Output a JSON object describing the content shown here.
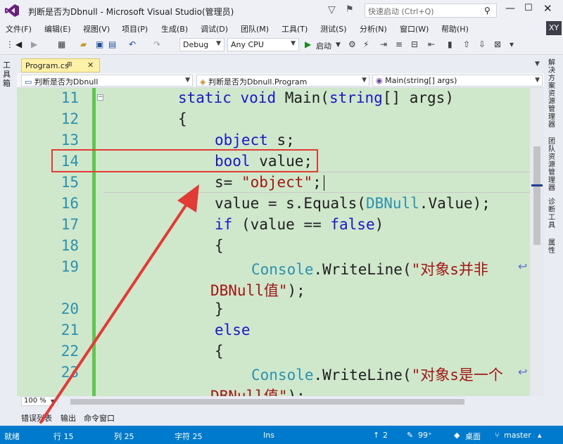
{
  "window": {
    "title": "判断是否为Dbnull - Microsoft Visual Studio(管理员)",
    "quick_launch_placeholder": "快速启动 (Ctrl+Q)",
    "minimize": "—",
    "maximize": "☐",
    "close": "✕",
    "account_initials": "XY"
  },
  "menu": [
    "文件(F)",
    "编辑(E)",
    "视图(V)",
    "项目(P)",
    "生成(B)",
    "调试(D)",
    "团队(M)",
    "工具(T)",
    "测试(S)",
    "分析(N)",
    "窗口(W)",
    "帮助(H)"
  ],
  "toolbar": {
    "configuration": "Debug",
    "platform": "Any CPU",
    "start_label": "启动"
  },
  "left_panel_tab": "工具箱",
  "right_panel_tabs": [
    "解决方案资源管理器",
    "团队资源管理器",
    "诊断工具",
    "属性"
  ],
  "document_tab": {
    "label": "Program.cs",
    "pin": "⊞",
    "close": "✕"
  },
  "navbar": {
    "project": "判断是否为Dbnull",
    "class": "判断是否为Dbnull.Program",
    "member": "Main(string[] args)"
  },
  "code_lines": [
    {
      "number": "11",
      "text": "static void Main(string[] args)"
    },
    {
      "number": "12",
      "text": "{"
    },
    {
      "number": "13",
      "text": "object s;"
    },
    {
      "number": "14",
      "text": "bool value;"
    },
    {
      "number": "15",
      "text": "s= \"object\";"
    },
    {
      "number": "16",
      "text": "value = s.Equals(DBNull.Value);"
    },
    {
      "number": "17",
      "text": "if (value == false)"
    },
    {
      "number": "18",
      "text": "{"
    },
    {
      "number": "19",
      "text": "Console.WriteLine(\"对象s并非DBNull值\");"
    },
    {
      "number": "20",
      "text": "}"
    },
    {
      "number": "21",
      "text": "else"
    },
    {
      "number": "22",
      "text": "{"
    },
    {
      "number": "23",
      "text": "Console.WriteLine(\"对象s是一个DBNull值\");"
    }
  ],
  "zoom": "100 %",
  "bottom_tabs": [
    "错误列表",
    "输出",
    "命令窗口"
  ],
  "status": {
    "ready": "就绪",
    "line": "行 15",
    "col": "列 25",
    "char": "字符 25",
    "mode": "Ins",
    "up_count": "2",
    "edits": "99⁺",
    "desktop": "桌面",
    "branch": "master"
  }
}
